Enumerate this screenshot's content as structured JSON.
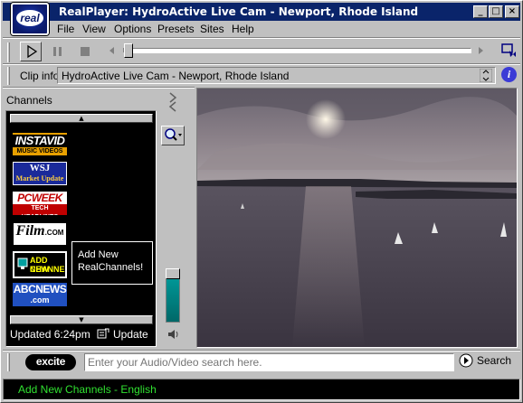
{
  "window": {
    "title": "RealPlayer: HydroActive Live Cam - Newport, Rhode Island",
    "logo_text": "real"
  },
  "menu": {
    "items": [
      {
        "label": "File"
      },
      {
        "label": "View"
      },
      {
        "label": "Options"
      },
      {
        "label": "Presets"
      },
      {
        "label": "Sites"
      },
      {
        "label": "Help"
      }
    ]
  },
  "clip_info": {
    "label": "Clip info:",
    "value": "HydroActive Live Cam - Newport, Rhode Island"
  },
  "channels": {
    "title": "Channels",
    "logos": [
      {
        "name": "instavid",
        "line1": "INSTAVID",
        "line2": "MUSIC VIDEOS"
      },
      {
        "name": "wsj",
        "line1": "WSJ",
        "line2": "Market Update"
      },
      {
        "name": "pcweek",
        "line1": "PCWEEK",
        "line2": "TECH HEADLINES"
      },
      {
        "name": "film",
        "line1": "Film",
        "line2": ".COM"
      },
      {
        "name": "add-new",
        "line1": "ADD NEW",
        "line2": "CHANNELS"
      },
      {
        "name": "abcnews",
        "line1": "ABCNEWS",
        "line2": ".com"
      }
    ],
    "tooltip": "Add New RealChannels!",
    "updated": "Updated 6:24pm",
    "update_label": "Update"
  },
  "search": {
    "logo_text": "excite",
    "placeholder": "Enter your Audio/Video search here.",
    "button_label": "Search"
  },
  "status": {
    "text": "Add New Channels - English"
  },
  "colors": {
    "titlebar": "#0a246a",
    "status_text": "#30e030",
    "volume": "#00a0a0"
  }
}
